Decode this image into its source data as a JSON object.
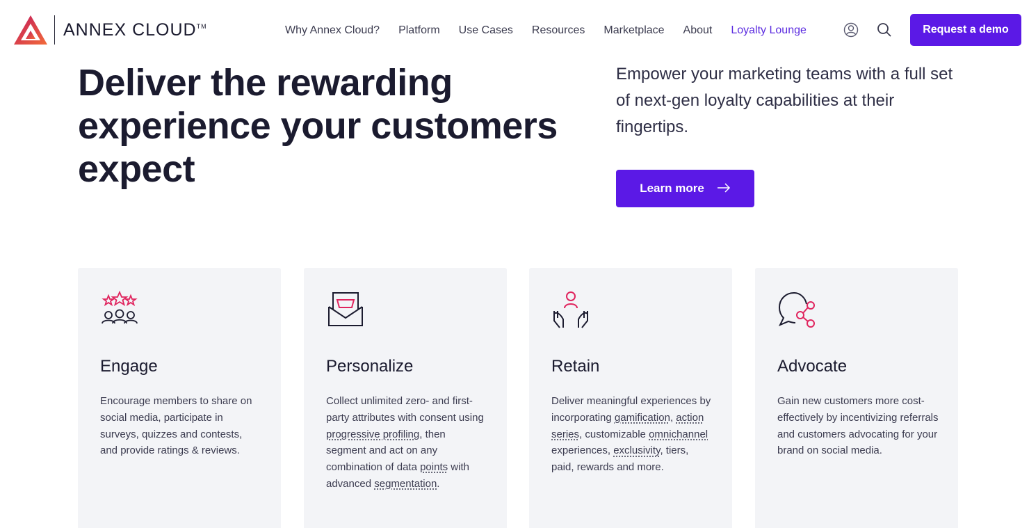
{
  "brand": {
    "name": "ANNEX CLOUD",
    "trademark": "TM"
  },
  "nav": {
    "items": [
      {
        "label": "Why Annex Cloud?"
      },
      {
        "label": "Platform"
      },
      {
        "label": "Use Cases"
      },
      {
        "label": "Resources"
      },
      {
        "label": "Marketplace"
      },
      {
        "label": "About"
      },
      {
        "label": "Loyalty Lounge"
      }
    ],
    "account_icon": "user-icon",
    "search_icon": "search-icon",
    "cta_label": "Request a demo"
  },
  "hero": {
    "title": "Deliver the rewarding experience your customers expect",
    "subtitle": "Empower your marketing teams with a full set of next-gen loyalty capabilities at their fingertips.",
    "button_label": "Learn more",
    "button_icon": "arrow-right-icon"
  },
  "cards": [
    {
      "title": "Engage",
      "icon": "stars-group-icon",
      "parts": [
        "Encourage members to share on social media, participate in surveys, quizzes and contests, and provide ratings & reviews."
      ]
    },
    {
      "title": "Personalize",
      "icon": "envelope-cart-icon",
      "parts": [
        "Collect unlimited zero- and first-party attributes with consent using ",
        "progressive profiling",
        ", then segment and act on any combination of data ",
        "points",
        " with advanced ",
        "segmentation",
        "."
      ]
    },
    {
      "title": "Retain",
      "icon": "hands-person-icon",
      "parts": [
        "Deliver meaningful experiences by incorporating ",
        "gamification",
        ", ",
        "action series",
        ", customizable ",
        "omnichannel",
        " experiences, ",
        "exclusivity",
        ", tiers, paid, rewards and more."
      ]
    },
    {
      "title": "Advocate",
      "icon": "chat-share-icon",
      "parts": [
        "Gain new customers more cost-effectively by incentivizing referrals and customers advocating for your brand on social media."
      ]
    }
  ],
  "colors": {
    "primary": "#5b19e6",
    "accent_pink": "#e0245e",
    "card_bg": "#f3f4f7",
    "text_dark": "#1b1b2f"
  }
}
